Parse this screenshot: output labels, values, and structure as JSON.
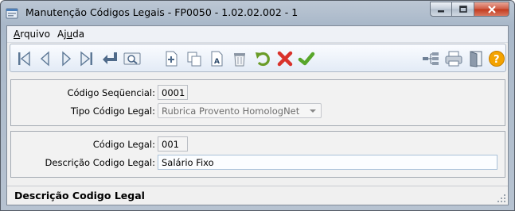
{
  "window": {
    "title": "Manutenção Códigos Legais - FP0050 - 1.02.02.002 - 1",
    "buttons": [
      "minimize",
      "maximize",
      "close"
    ]
  },
  "menu": {
    "arquivo_u": "A",
    "arquivo_rest": "rquivo",
    "ajuda_pre": "Aj",
    "ajuda_u": "u",
    "ajuda_post": "da"
  },
  "toolbar": {
    "icons": [
      "first-icon",
      "previous-icon",
      "next-icon",
      "last-icon",
      "goto-icon",
      "search-icon",
      "add-icon",
      "copy-icon",
      "edit-icon",
      "delete-icon",
      "undo-icon",
      "cancel-icon",
      "save-icon",
      "hierarchy-icon",
      "print-icon",
      "exit-icon",
      "help-icon"
    ],
    "colors": {
      "cancel": "#d9322b",
      "save": "#58a62a",
      "undo": "#6a9c28",
      "help": "#f4a300"
    }
  },
  "form": {
    "codigo_sequencial": {
      "label": "Código Seqüencial:",
      "value": "0001"
    },
    "tipo_codigo_legal": {
      "label": "Tipo Código Legal:",
      "value": "Rubrica Provento HomologNet"
    },
    "codigo_legal": {
      "label": "Código Legal:",
      "value": "001"
    },
    "descricao_codigo_legal": {
      "label": "Descrição Codigo Legal:",
      "value": "Salário Fixo"
    }
  },
  "status": {
    "text": "Descrição Codigo Legal"
  }
}
